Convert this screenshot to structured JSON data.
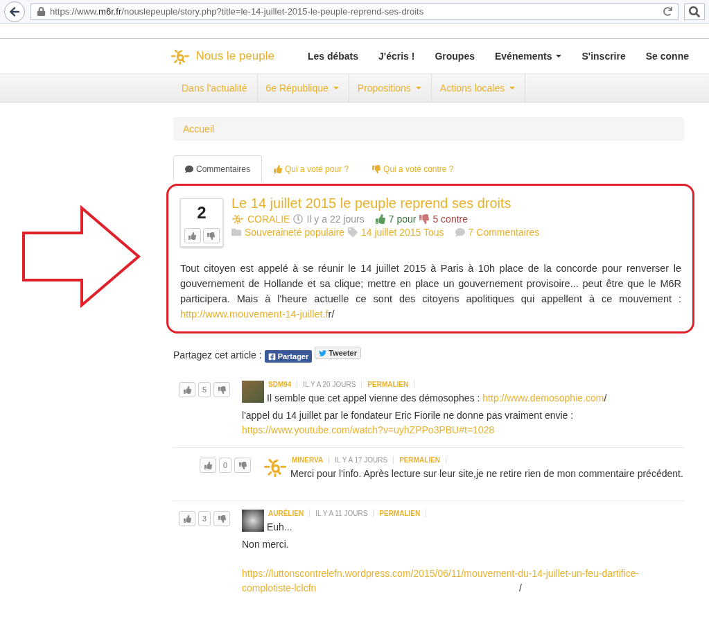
{
  "browser": {
    "url_scheme": "https://www.",
    "url_domain": "m6r.fr",
    "url_path": "/nouslepeuple/story.php?title=le-14-juillet-2015-le-peuple-reprend-ses-droits"
  },
  "header": {
    "brand": "Nous le peuple",
    "nav": [
      {
        "label": "Les débats",
        "dropdown": false
      },
      {
        "label": "J'écris !",
        "dropdown": false
      },
      {
        "label": "Groupes",
        "dropdown": false
      },
      {
        "label": "Evénements",
        "dropdown": true
      },
      {
        "label": "S'inscrire",
        "dropdown": false
      },
      {
        "label": "Se conne",
        "dropdown": false
      }
    ]
  },
  "subnav": [
    {
      "label": "Dans l'actualité",
      "dropdown": false
    },
    {
      "label": "6e République",
      "dropdown": true
    },
    {
      "label": "Propositions",
      "dropdown": true
    },
    {
      "label": "Actions locales",
      "dropdown": true
    }
  ],
  "breadcrumb": "Accueil",
  "tabs": [
    {
      "label": "Commentaires",
      "kind": "comment",
      "selected": true
    },
    {
      "label": "Qui a voté pour ?",
      "kind": "up",
      "selected": false
    },
    {
      "label": "Qui a voté contre ?",
      "kind": "down",
      "selected": false
    }
  ],
  "post": {
    "score": "2",
    "title": "Le 14 juillet 2015 le peuple reprend ses droits",
    "author": "CORALIE",
    "time": "Il y a 22 jours",
    "votes_for": "7 pour",
    "votes_against": "5 contre",
    "category": "Souveraineté populaire",
    "tags": "14 juillet 2015 Tous",
    "comments": "7 Commentaires",
    "body": [
      {
        "text": "Tout citoyen est appelé à se réunir le 14 juillet 2015 à Paris à 10h place de la concorde pour renverser le gouvernement de Hollande et sa clique; mettre en place un gouvernement provisoire... peut être que le M6R participera. Mais à l'heure actuelle ce sont des citoyens apolitiques qui appellent à ce mouvement : ",
        "link": false
      },
      {
        "text": "http://www.mouvement-14-juillet.f",
        "link": true
      },
      {
        "text": "r/",
        "link": false
      }
    ]
  },
  "share": {
    "label": "Partagez cet article :",
    "facebook": "Partager",
    "twitter": "Tweeter"
  },
  "comments": [
    {
      "author": "SDM94",
      "time": "IL Y A 20 JOURS",
      "permalink": "PERMALIEN",
      "score": "5",
      "kind": "photo",
      "paragraphs": [
        [
          {
            "text": "Il semble que cet appel vienne des démosophes : ",
            "link": false
          },
          {
            "text": "http://www.demosophie.com",
            "link": true
          },
          {
            "text": "/",
            "link": false
          }
        ],
        [
          {
            "text": "l'appel du 14 juillet par le fondateur Eric Fiorile ne donne pas vraiment envie : ",
            "link": false
          },
          {
            "text": "https://www.youtube.com/watch?v=uyhZPPo3PBU#t=1028",
            "link": true
          }
        ]
      ],
      "children": [
        {
          "author": "MINERVA",
          "time": "IL Y A 17 JOURS",
          "permalink": "PERMALIEN",
          "score": "0",
          "kind": "logo",
          "paragraphs": [
            [
              {
                "text": "Merci pour l'info. Après lecture sur leur site,je ne retire rien de mon commentaire précédent.",
                "link": false
              }
            ]
          ]
        }
      ]
    },
    {
      "author": "AURÉLIEN",
      "time": "IL Y A 11 JOURS",
      "permalink": "PERMALIEN",
      "score": "3",
      "kind": "photo",
      "paragraphs": [
        [
          {
            "text": "Euh...",
            "link": false
          }
        ],
        [
          {
            "text": "Non merci.",
            "link": false
          }
        ],
        [
          {
            "text": "https://luttonscontrelefn.wordpress.com/2015/06/11/mouvement-du-14-juillet-un-feu-dartifice-complotiste-lclcfn",
            "link": true
          },
          {
            "text": "/",
            "link": false
          }
        ]
      ]
    }
  ]
}
